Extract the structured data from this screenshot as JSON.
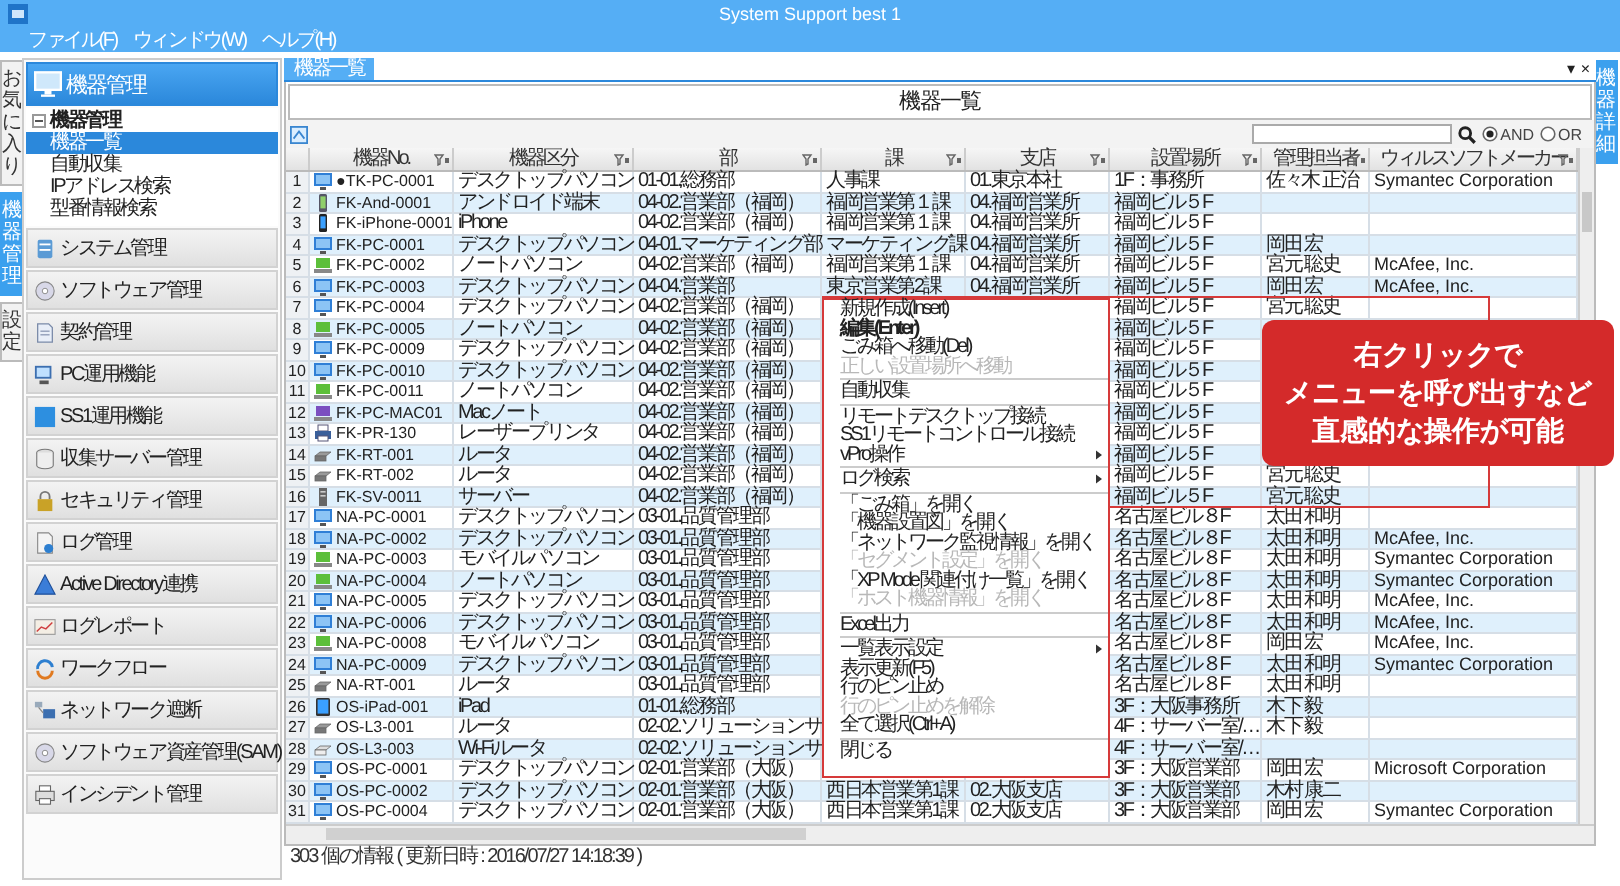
{
  "window": {
    "title": "System Support best 1"
  },
  "menu_bar": [
    "ファイル(F)",
    "ウィンドウ(W)",
    "ヘルプ(H)"
  ],
  "side_tabs": [
    {
      "label": "お気に入り",
      "selected": false
    },
    {
      "label": "機器管理",
      "selected": true
    },
    {
      "label": "設定",
      "selected": false
    }
  ],
  "sidebar": {
    "categories": [
      {
        "label": "機器管理",
        "selected": true,
        "tree": [
          {
            "label": "機器管理",
            "expanded": true,
            "children": [
              {
                "label": "機器一覧",
                "selected": true
              },
              {
                "label": "自動収集",
                "selected": false
              },
              {
                "label": "IPアドレス検索",
                "selected": false
              },
              {
                "label": "型番情報検索",
                "selected": false
              }
            ]
          }
        ]
      },
      {
        "label": "システム管理",
        "selected": false
      },
      {
        "label": "ソフトウェア管理",
        "selected": false
      },
      {
        "label": "契約管理",
        "selected": false
      },
      {
        "label": "PC運用機能",
        "selected": false
      },
      {
        "label": "SS1運用機能",
        "selected": false
      },
      {
        "label": "収集サーバー管理",
        "selected": false
      },
      {
        "label": "セキュリティ管理",
        "selected": false
      },
      {
        "label": "ログ管理",
        "selected": false
      },
      {
        "label": "Active Directory連携",
        "selected": false
      },
      {
        "label": "ログレポート",
        "selected": false
      },
      {
        "label": "ワークフロー",
        "selected": false
      },
      {
        "label": "ネットワーク遮断",
        "selected": false
      },
      {
        "label": "ソフトウェア資産管理(SAM)",
        "selected": false
      },
      {
        "label": "インシデント管理",
        "selected": false
      }
    ]
  },
  "document_tabs": [
    {
      "label": "機器一覧",
      "selected": true
    }
  ],
  "pane_controls": [
    "▾",
    "×"
  ],
  "right_tabs": [
    {
      "label": "機器詳細",
      "selected": true
    }
  ],
  "panel_title": "機器一覧",
  "search": {
    "modes": [
      {
        "label": "AND",
        "selected": true
      },
      {
        "label": "OR",
        "selected": false
      }
    ]
  },
  "table": {
    "columns": [
      "機器No.",
      "機器区分",
      "部",
      "課",
      "支店",
      "設置場所",
      "管理担当者",
      "ウィルスソフトメーカー"
    ],
    "rows": [
      {
        "n": "1",
        "kind": "desktop",
        "no": "●TK-PC-0001",
        "type": "デスクトップパソコン",
        "dept": "01-01.総務部",
        "section": "人事課",
        "branch": "01.東京本社",
        "location": "1F：事務所",
        "manager": "佐々木 正治",
        "antivirus": "Symantec Corporation"
      },
      {
        "n": "2",
        "kind": "android",
        "no": "FK-And-0001",
        "type": "アンドロイド端末",
        "dept": "04-02.営業部（福岡）",
        "section": "福岡営業第１課",
        "branch": "04.福岡営業所",
        "location": "福岡ビル５F"
      },
      {
        "n": "3",
        "kind": "phone",
        "no": "FK-iPhone-0001",
        "type": "iPhone",
        "dept": "04-02.営業部（福岡）",
        "section": "福岡営業第１課",
        "branch": "04.福岡営業所",
        "location": "福岡ビル５F"
      },
      {
        "n": "4",
        "kind": "desktop",
        "no": "FK-PC-0001",
        "type": "デスクトップパソコン",
        "dept": "04-01.マーケティング部",
        "section": "マーケティング課",
        "branch": "04.福岡営業所",
        "location": "福岡ビル５F",
        "manager": "岡田 宏"
      },
      {
        "n": "5",
        "kind": "laptop",
        "no": "FK-PC-0002",
        "type": "ノートパソコン",
        "dept": "04-02.営業部（福岡）",
        "section": "福岡営業第１課",
        "branch": "04.福岡営業所",
        "location": "福岡ビル５F",
        "manager": "宮元 聡史",
        "antivirus": "McAfee, Inc."
      },
      {
        "n": "6",
        "kind": "desktop",
        "no": "FK-PC-0003",
        "type": "デスクトップパソコン",
        "dept": "04-04.営業部",
        "section": "東京営業第2課",
        "branch": "04.福岡営業所",
        "location": "福岡ビル５F",
        "manager": "岡田 宏",
        "antivirus": "McAfee, Inc."
      },
      {
        "n": "7",
        "kind": "desktop",
        "no": "FK-PC-0004",
        "type": "デスクトップパソコン",
        "dept": "04-02.営業部（福岡）",
        "location": "福岡ビル５F",
        "manager": "宮元 聡史"
      },
      {
        "n": "8",
        "kind": "laptop",
        "no": "FK-PC-0005",
        "type": "ノートパソコン",
        "dept": "04-02.営業部（福岡）",
        "location": "福岡ビル５F"
      },
      {
        "n": "9",
        "kind": "desktop",
        "no": "FK-PC-0009",
        "type": "デスクトップパソコン",
        "dept": "04-02.営業部（福岡）",
        "location": "福岡ビル５F"
      },
      {
        "n": "10",
        "kind": "desktop",
        "no": "FK-PC-0010",
        "type": "デスクトップパソコン",
        "dept": "04-02.営業部（福岡）",
        "location": "福岡ビル５F"
      },
      {
        "n": "11",
        "kind": "laptop",
        "no": "FK-PC-0011",
        "type": "ノートパソコン",
        "dept": "04-02.営業部（福岡）",
        "location": "福岡ビル５F"
      },
      {
        "n": "12",
        "kind": "mac",
        "no": "FK-PC-MAC01",
        "type": "Macノート",
        "dept": "04-02.営業部（福岡）",
        "location": "福岡ビル５F"
      },
      {
        "n": "13",
        "kind": "printer",
        "no": "FK-PR-130",
        "type": "レーザープリンタ",
        "dept": "04-02.営業部（福岡）",
        "location": "福岡ビル５F"
      },
      {
        "n": "14",
        "kind": "router",
        "no": "FK-RT-001",
        "type": "ルータ",
        "dept": "04-02.営業部（福岡）",
        "location": "福岡ビル５F"
      },
      {
        "n": "15",
        "kind": "router",
        "no": "FK-RT-002",
        "type": "ルータ",
        "dept": "04-02.営業部（福岡）",
        "location": "福岡ビル５F",
        "manager": "宮元 聡史"
      },
      {
        "n": "16",
        "kind": "server",
        "no": "FK-SV-0011",
        "type": "サーバー",
        "dept": "04-02.営業部（福岡）",
        "location": "福岡ビル５F",
        "manager": "宮元 聡史"
      },
      {
        "n": "17",
        "kind": "desktop",
        "no": "NA-PC-0001",
        "type": "デスクトップパソコン",
        "dept": "03-01.品質管理部",
        "location": "名古屋ビル８F",
        "manager": "太田 和明"
      },
      {
        "n": "18",
        "kind": "desktop",
        "no": "NA-PC-0002",
        "type": "デスクトップパソコン",
        "dept": "03-01.品質管理部",
        "location": "名古屋ビル８F",
        "manager": "太田 和明",
        "antivirus": "McAfee, Inc."
      },
      {
        "n": "19",
        "kind": "laptop",
        "no": "NA-PC-0003",
        "type": "モバイルパソコン",
        "dept": "03-01.品質管理部",
        "location": "名古屋ビル８F",
        "manager": "太田 和明",
        "antivirus": "Symantec Corporation"
      },
      {
        "n": "20",
        "kind": "laptop",
        "no": "NA-PC-0004",
        "type": "ノートパソコン",
        "dept": "03-01.品質管理部",
        "location": "名古屋ビル８F",
        "manager": "太田 和明",
        "antivirus": "Symantec Corporation"
      },
      {
        "n": "21",
        "kind": "desktop",
        "no": "NA-PC-0005",
        "type": "デスクトップパソコン",
        "dept": "03-01.品質管理部",
        "location": "名古屋ビル８F",
        "manager": "太田 和明",
        "antivirus": "McAfee, Inc."
      },
      {
        "n": "22",
        "kind": "desktop",
        "no": "NA-PC-0006",
        "type": "デスクトップパソコン",
        "dept": "03-01.品質管理部",
        "location": "名古屋ビル８F",
        "manager": "太田 和明",
        "antivirus": "McAfee, Inc."
      },
      {
        "n": "23",
        "kind": "laptop",
        "no": "NA-PC-0008",
        "type": "モバイルパソコン",
        "dept": "03-01.品質管理部",
        "location": "名古屋ビル８F",
        "manager": "岡田 宏",
        "antivirus": "McAfee, Inc."
      },
      {
        "n": "24",
        "kind": "desktop",
        "no": "NA-PC-0009",
        "type": "デスクトップパソコン",
        "dept": "03-01.品質管理部",
        "location": "名古屋ビル８F",
        "manager": "太田 和明",
        "antivirus": "Symantec Corporation"
      },
      {
        "n": "25",
        "kind": "router",
        "no": "NA-RT-001",
        "type": "ルータ",
        "dept": "03-01.品質管理部",
        "location": "名古屋ビル８F",
        "manager": "太田 和明"
      },
      {
        "n": "26",
        "kind": "tablet",
        "no": "OS-iPad-001",
        "type": "iPad",
        "dept": "01-01.総務部",
        "location": "3F：大阪事務所",
        "manager": "木下 毅"
      },
      {
        "n": "27",
        "kind": "router",
        "no": "OS-L3-001",
        "type": "ルータ",
        "dept": "02-02.ソリューションサ",
        "location": "4F：サーバー室/…",
        "manager": "木下 毅"
      },
      {
        "n": "28",
        "kind": "wifi",
        "no": "OS-L3-003",
        "type": "Wi-Fiルータ",
        "dept": "02-02.ソリューションサ",
        "location": "4F：サーバー室/…"
      },
      {
        "n": "29",
        "kind": "desktop",
        "no": "OS-PC-0001",
        "type": "デスクトップパソコン",
        "dept": "02-01.営業部（大阪）",
        "location": "3F：大阪営業部",
        "manager": "岡田 宏",
        "antivirus": "Microsoft Corporation"
      },
      {
        "n": "30",
        "kind": "desktop",
        "no": "OS-PC-0002",
        "type": "デスクトップパソコン",
        "dept": "02-01.営業部（大阪）",
        "section": "西日本営業第1課",
        "branch": "02.大阪支店",
        "location": "3F：大阪営業部",
        "manager": "木村 康二"
      },
      {
        "n": "31",
        "kind": "desktop",
        "no": "OS-PC-0004",
        "type": "デスクトップパソコン",
        "dept": "02-01.営業部（大阪）",
        "section": "西日本営業第1課",
        "branch": "02.大阪支店",
        "location": "3F：大阪営業部",
        "manager": "岡田 宏",
        "antivirus": "Symantec Corporation"
      }
    ]
  },
  "context_menu": {
    "items": [
      {
        "kind": "item",
        "label": "新規作成(Insert)",
        "disabled": false,
        "default": false,
        "submenu": false
      },
      {
        "kind": "item",
        "label": "編集(Enter)",
        "disabled": false,
        "default": true,
        "submenu": false
      },
      {
        "kind": "item",
        "label": "ごみ箱へ移動(Del)",
        "disabled": false,
        "default": false,
        "submenu": false
      },
      {
        "kind": "item",
        "label": "正しい設置場所へ移動",
        "disabled": true,
        "default": false,
        "submenu": false
      },
      {
        "kind": "separator"
      },
      {
        "kind": "item",
        "label": "自動収集",
        "disabled": false,
        "default": false,
        "submenu": false
      },
      {
        "kind": "separator"
      },
      {
        "kind": "item",
        "label": "リモートデスクトップ接続",
        "disabled": false,
        "default": false,
        "submenu": false
      },
      {
        "kind": "item",
        "label": "SS1リモートコントロール接続",
        "disabled": false,
        "default": false,
        "submenu": false
      },
      {
        "kind": "item",
        "label": "vPro操作",
        "disabled": false,
        "default": false,
        "submenu": true
      },
      {
        "kind": "separator"
      },
      {
        "kind": "item",
        "label": "ログ検索",
        "disabled": false,
        "default": false,
        "submenu": true
      },
      {
        "kind": "separator"
      },
      {
        "kind": "item",
        "label": "「ごみ箱」を開く",
        "disabled": false,
        "default": false,
        "submenu": false
      },
      {
        "kind": "item",
        "label": "「機器設置図」を開く",
        "disabled": false,
        "default": false,
        "submenu": false
      },
      {
        "kind": "item",
        "label": "「ネットワーク監視情報」を開く",
        "disabled": false,
        "default": false,
        "submenu": false
      },
      {
        "kind": "item",
        "label": "「セグメント設定」を開く",
        "disabled": true,
        "default": false,
        "submenu": false
      },
      {
        "kind": "item",
        "label": "「XP Mode 関連付け一覧」を開く",
        "disabled": false,
        "default": false,
        "submenu": false
      },
      {
        "kind": "item",
        "label": "「ホスト機器情報」を開く",
        "disabled": true,
        "default": false,
        "submenu": false
      },
      {
        "kind": "separator"
      },
      {
        "kind": "item",
        "label": "Excel出力",
        "disabled": false,
        "default": false,
        "submenu": false
      },
      {
        "kind": "separator"
      },
      {
        "kind": "item",
        "label": "一覧表示設定",
        "disabled": false,
        "default": false,
        "submenu": true
      },
      {
        "kind": "item",
        "label": "表示更新(F5)",
        "disabled": false,
        "default": false,
        "submenu": false
      },
      {
        "kind": "item",
        "label": "行のピン止め",
        "disabled": false,
        "default": false,
        "submenu": false
      },
      {
        "kind": "item",
        "label": "行のピン止めを解除",
        "disabled": true,
        "default": false,
        "submenu": false
      },
      {
        "kind": "item",
        "label": "全て選択(Ctrl+A)",
        "disabled": false,
        "default": false,
        "submenu": false
      },
      {
        "kind": "separator"
      },
      {
        "kind": "item",
        "label": "閉じる",
        "disabled": false,
        "default": false,
        "submenu": false
      }
    ]
  },
  "callout": [
    "右クリックで",
    "メニューを呼び出すなど",
    "直感的な操作が可能"
  ],
  "status_bar": "303 個の情報 ( 更新日時 : 2016/07/27 14:18:39 )"
}
